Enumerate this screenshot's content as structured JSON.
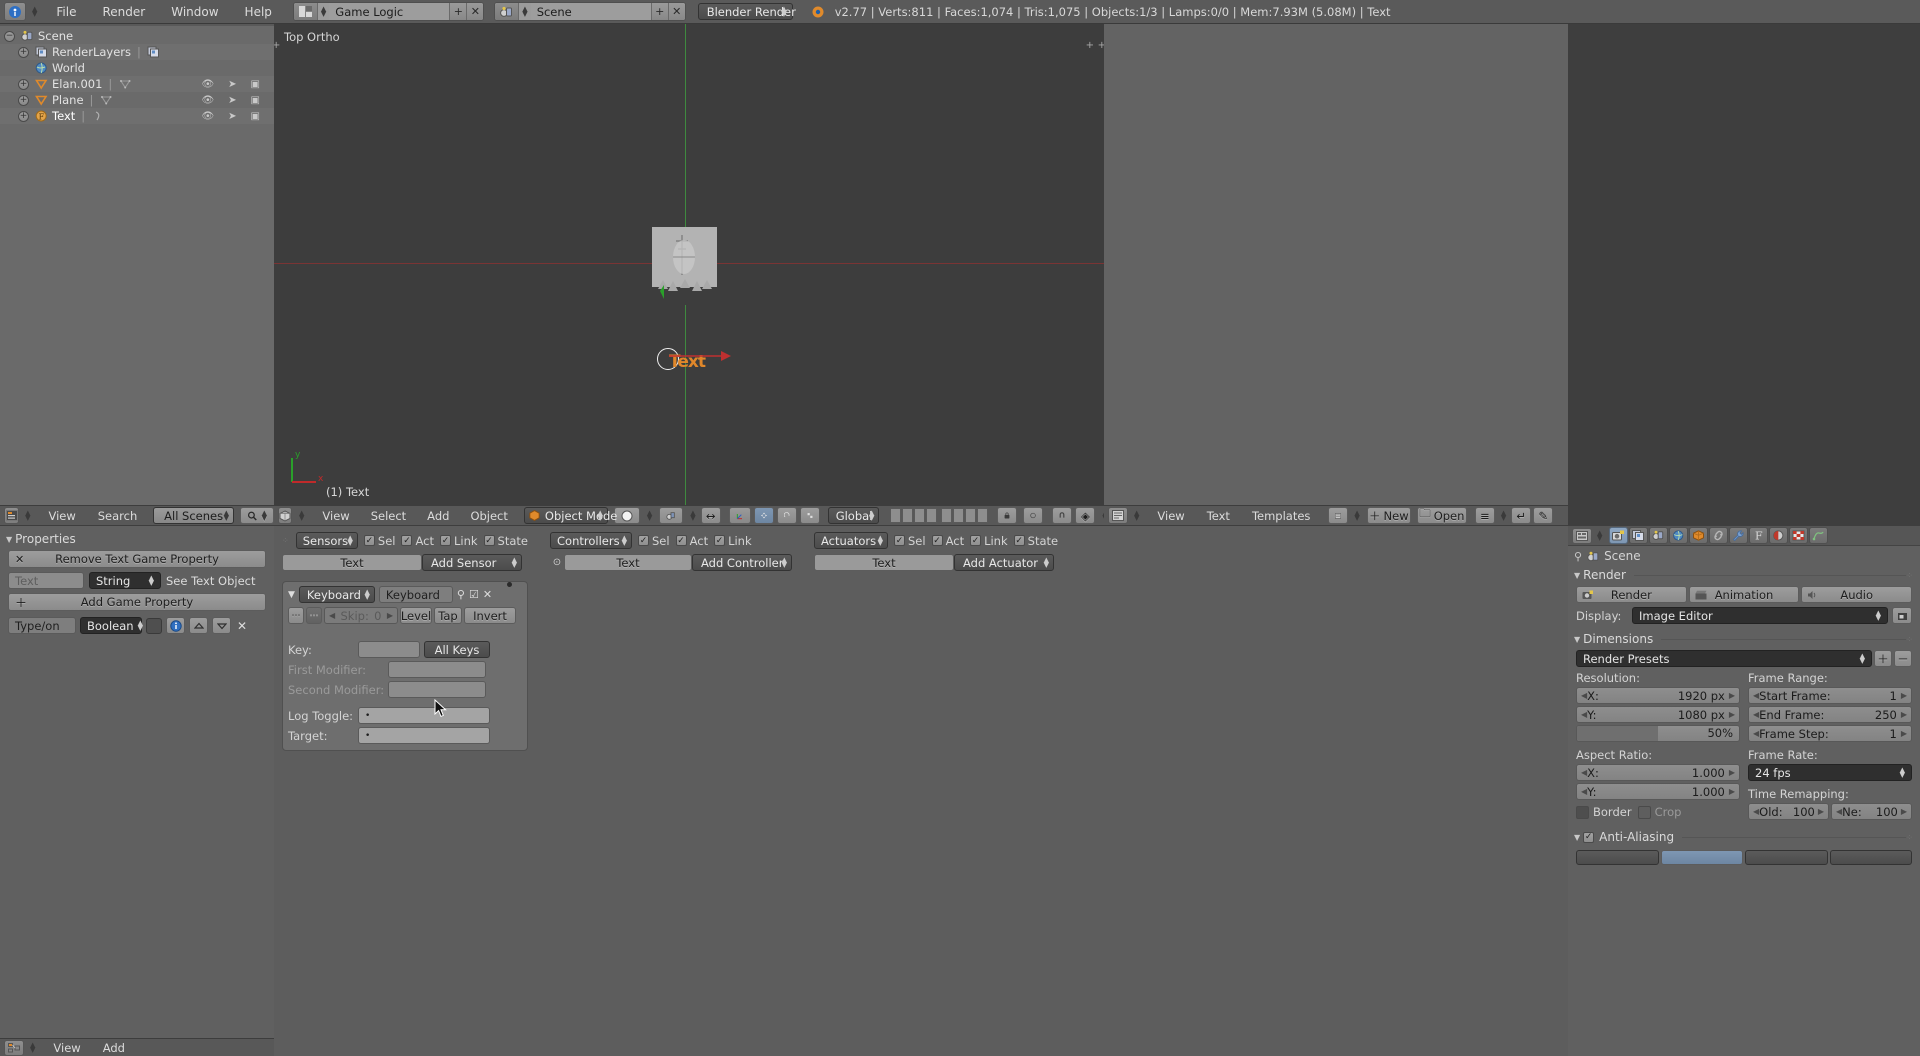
{
  "topbar": {
    "logo_icon": "blender-logo-icon",
    "menus": [
      "File",
      "Render",
      "Window",
      "Help"
    ],
    "screen_selector": {
      "icon": "screen-layout-icon",
      "value": "Game Logic",
      "add": "+",
      "remove": "x"
    },
    "scene_selector": {
      "icon": "scene-icon",
      "value": "Scene",
      "add": "+",
      "remove": "x"
    },
    "engine_selector": {
      "value": "Blender Render"
    },
    "status": "v2.77 | Verts:811 | Faces:1,074 | Tris:1,075 | Objects:1/3 | Lamps:0/0 | Mem:7.93M (5.08M) | Text"
  },
  "outliner": {
    "rows": [
      {
        "label": "Scene",
        "icon": "scene-icon",
        "indent": 0,
        "expander": "collapse",
        "selected": false
      },
      {
        "label": "RenderLayers",
        "icon": "renderlayers-icon",
        "indent": 1,
        "expander": "expand",
        "selected": false
      },
      {
        "label": "World",
        "icon": "world-icon",
        "indent": 1,
        "expander": "none",
        "selected": false
      },
      {
        "label": "Elan.001",
        "icon": "mesh-icon",
        "indent": 1,
        "expander": "expand",
        "selected": false
      },
      {
        "label": "Plane",
        "icon": "mesh-icon",
        "indent": 1,
        "expander": "expand",
        "selected": false
      },
      {
        "label": "Text",
        "icon": "font-icon",
        "indent": 1,
        "expander": "expand",
        "selected": true
      }
    ],
    "header": {
      "menus": [
        "View",
        "Search"
      ],
      "display_mode": "All Scenes",
      "filter_icon": "search-icon"
    }
  },
  "viewport": {
    "view_name": "Top Ortho",
    "object_info": "(1) Text",
    "axis_x": "x",
    "axis_y": "y",
    "text_object_label": "Text",
    "header": {
      "menus": [
        "View",
        "Select",
        "Add",
        "Object"
      ],
      "mode": "Object Mode",
      "transform_orientation": "Global",
      "mode_icon": "object-mode-icon",
      "shading_icon": "shading-solid-icon",
      "pivot_icon": "pivot-icon",
      "snap_icon": "magnet-icon",
      "manipulator_icons": [
        "translate-icon",
        "rotate-icon",
        "scale-icon"
      ]
    }
  },
  "right_blank": {
    "header": {
      "menus": [
        "View",
        "Text",
        "Templates"
      ],
      "new_button": "New",
      "open_button": "Open",
      "editor_icon": "text-editor-icon"
    }
  },
  "properties_panel": {
    "section_title": "Properties",
    "remove_button": "Remove Text Game Property",
    "name_placeholder": "Text",
    "type_value": "String",
    "see_text_label": "See Text Object",
    "add_button": "Add Game Property",
    "prop_row": {
      "name": "Type/on",
      "type": "Boolean",
      "value_toggle": "",
      "info_icon": "info-icon",
      "move_up_icon": "chevron-up-icon",
      "move_down_icon": "chevron-down-icon",
      "delete_icon": "x-icon"
    },
    "footer": {
      "menus": [
        "View",
        "Add"
      ],
      "editor_icon": "logic-editor-icon"
    }
  },
  "logic": {
    "sensors": {
      "title": "Sensors",
      "filters": [
        {
          "label": "Sel",
          "checked": true
        },
        {
          "label": "Act",
          "checked": true
        },
        {
          "label": "Link",
          "checked": true
        },
        {
          "label": "State",
          "checked": true
        }
      ],
      "object_name": "Text",
      "add_button": "Add Sensor",
      "sensor": {
        "type": "Keyboard",
        "name": "Keyboard",
        "pin_icon": "pin-icon",
        "state_icon": "check-icon",
        "close_icon": "x-icon",
        "pulse_true_icon": "pulse-true-icon",
        "pulse_false_icon": "pulse-false-icon",
        "skip_label": "Skip:",
        "skip_value": "0",
        "level_button": "Level",
        "tap_button": "Tap",
        "invert_button": "Invert",
        "key_label": "Key:",
        "key_value": "",
        "all_keys_button": "All Keys",
        "first_modifier_label": "First Modifier:",
        "first_modifier_value": "",
        "second_modifier_label": "Second Modifier:",
        "second_modifier_value": "",
        "log_toggle_label": "Log Toggle:",
        "log_toggle_value": "",
        "target_label": "Target:",
        "target_value": ""
      }
    },
    "controllers": {
      "title": "Controllers",
      "filters": [
        {
          "label": "Sel",
          "checked": true
        },
        {
          "label": "Act",
          "checked": true
        },
        {
          "label": "Link",
          "checked": true
        }
      ],
      "object_name": "Text",
      "add_button": "Add Controller",
      "state_icon": "state-dot-icon"
    },
    "actuators": {
      "title": "Actuators",
      "filters": [
        {
          "label": "Sel",
          "checked": true
        },
        {
          "label": "Act",
          "checked": true
        },
        {
          "label": "Link",
          "checked": true
        },
        {
          "label": "State",
          "checked": true
        }
      ],
      "object_name": "Text",
      "add_button": "Add Actuator"
    }
  },
  "right_properties": {
    "tabs": [
      {
        "name": "render-tab",
        "icon": "camera-icon",
        "active": true
      },
      {
        "name": "render-layers-tab",
        "icon": "renderlayers-icon",
        "active": false
      },
      {
        "name": "scene-tab",
        "icon": "scene-icon",
        "active": false
      },
      {
        "name": "world-tab",
        "icon": "world-icon",
        "active": false
      },
      {
        "name": "object-tab",
        "icon": "cube-icon",
        "active": false
      },
      {
        "name": "constraints-tab",
        "icon": "link-icon",
        "active": false
      },
      {
        "name": "modifiers-tab",
        "icon": "wrench-icon",
        "active": false
      },
      {
        "name": "data-tab",
        "icon": "font-icon",
        "active": false
      },
      {
        "name": "material-tab",
        "icon": "material-sphere-icon",
        "active": false
      },
      {
        "name": "texture-tab",
        "icon": "checker-icon",
        "active": false
      },
      {
        "name": "physics-tab",
        "icon": "physics-icon",
        "active": false
      }
    ],
    "breadcrumb": {
      "pin_icon": "pin-icon",
      "scene_icon": "scene-icon",
      "scene_name": "Scene"
    },
    "render": {
      "title": "Render",
      "render_button": "Render",
      "animation_button": "Animation",
      "audio_button": "Audio",
      "display_label": "Display:",
      "display_value": "Image Editor"
    },
    "dimensions": {
      "title": "Dimensions",
      "presets_value": "Render Presets",
      "resolution_label": "Resolution:",
      "res_x_label": "X:",
      "res_x_value": "1920 px",
      "res_y_label": "Y:",
      "res_y_value": "1080 px",
      "res_percent": "50%",
      "res_percent_fill": 50,
      "aspect_label": "Aspect Ratio:",
      "aspect_x_label": "X:",
      "aspect_x_value": "1.000",
      "aspect_y_label": "Y:",
      "aspect_y_value": "1.000",
      "border_label": "Border",
      "crop_label": "Crop",
      "frame_range_label": "Frame Range:",
      "start_frame_label": "Start Frame:",
      "start_frame_value": "1",
      "end_frame_label": "End Frame:",
      "end_frame_value": "250",
      "frame_step_label": "Frame Step:",
      "frame_step_value": "1",
      "frame_rate_label": "Frame Rate:",
      "frame_rate_value": "24 fps",
      "time_remapping_label": "Time Remapping:",
      "old_label": "Old:",
      "old_value": "100",
      "new_label": "Ne:",
      "new_value": "100"
    },
    "antialiasing": {
      "title": "Anti-Aliasing",
      "checked": true
    }
  },
  "colors": {
    "accent_orange": "#e08a2b",
    "header_gray": "#5a5a5a",
    "panel_gray": "#606060",
    "viewport_gray": "#3d3d3d",
    "axis_red": "#a02020",
    "axis_green": "#2a8a2a",
    "tab_blue": "#8fa8c4"
  }
}
